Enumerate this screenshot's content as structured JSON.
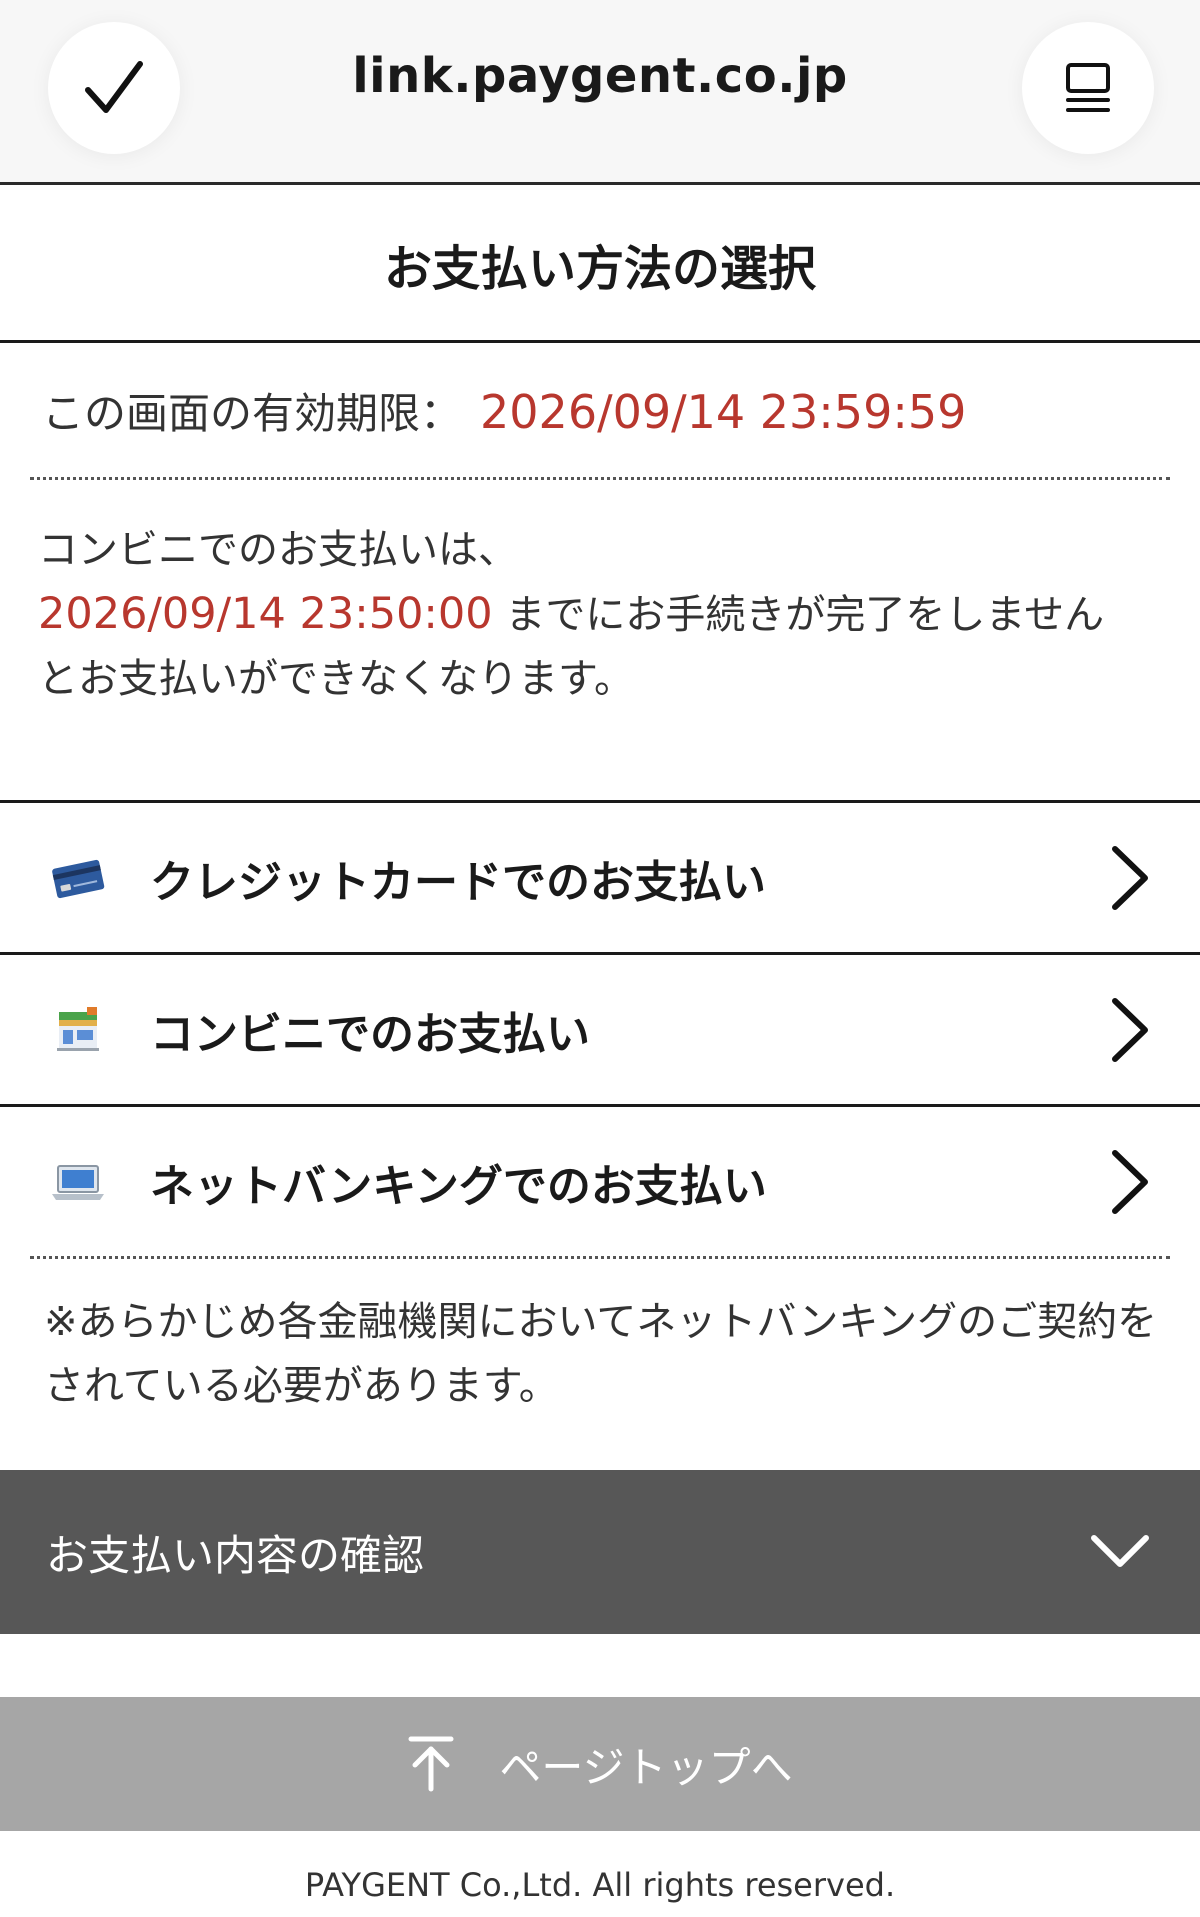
{
  "browser": {
    "url": "link.paygent.co.jp",
    "left_icon": "check-icon",
    "right_icon": "tabs-icon"
  },
  "page": {
    "title": "お支払い方法の選択"
  },
  "expiry": {
    "label": "この画面の有効期限：",
    "value": "2026/09/14 23:59:59"
  },
  "notice": {
    "line1": "コンビニでのお支払いは、",
    "deadline": "2026/09/14 23:50:00",
    "line2": " までにお手続きが完了をしません",
    "line3": "とお支払いができなくなります。"
  },
  "methods": [
    {
      "label": "クレジットカードでのお支払い",
      "icon": "credit-card-icon"
    },
    {
      "label": "コンビニでのお支払い",
      "icon": "convenience-store-icon"
    },
    {
      "label": "ネットバンキングでのお支払い",
      "icon": "laptop-icon"
    }
  ],
  "netbank_note": "※あらかじめ各金融機関においてネットバンキングのご契約をされている必要があります。",
  "confirm": {
    "label": "お支払い内容の確認",
    "icon": "chevron-down-icon"
  },
  "pagetop": {
    "label": "ページトップへ",
    "icon": "arrow-up-icon"
  },
  "footer": {
    "copyright": "PAYGENT Co.,Ltd. All rights reserved."
  },
  "colors": {
    "accent_red": "#b8372e",
    "confirm_bg": "#575757",
    "pagetop_bg": "#a6a6a6"
  }
}
